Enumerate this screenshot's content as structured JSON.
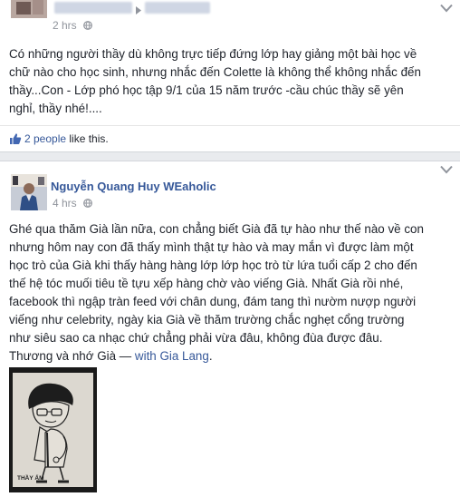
{
  "post1": {
    "author_name": "",
    "timestamp": "2 hrs",
    "body": "Có những người thầy dù không trực tiếp đứng lớp hay giảng một bài học về\nchữ nào cho học sinh, nhưng nhắc đến Colette là không thể không nhắc đến\nthầy...Con - Lớp phó học tập 9/1 của 15 năm trước -cầu chúc thầy sẽ yên\nnghỉ, thầy nhé!....",
    "likes": {
      "link_text": "2 people",
      "suffix": " like this."
    }
  },
  "post2": {
    "author_name": "Nguyễn Quang Huy WEaholic",
    "timestamp": "4 hrs",
    "body": "Ghé qua thăm Già lần nữa, con chẳng biết Già đã tự hào như thế nào về con\nnhưng hôm nay con đã thấy mình thật tự hào và may mắn vì được làm một\nhọc trò của Già khi thấy hàng hàng lớp lớp học trò từ lứa tuổi cấp 2 cho đến\nthế hệ tóc muối tiêu tề tựu xếp hàng chờ vào viếng Già. Nhất Già rồi nhé,\nfacebook thì ngập tràn feed với chân dung, đám tang thì nườm nượp người\nviếng như celebrity, ngày kia Già về thăm trường chắc nghẹt cổng trường\nnhư siêu sao ca nhạc chứ chẳng phải vừa đâu, không đùa được đâu.\nThương và nhớ Già — ",
    "tag_prefix": "with ",
    "tagged_person": "Gia Lang",
    "tag_suffix": ".",
    "photo_caption": "THẦY ẤM"
  },
  "icons": {
    "post_menu": "chevron-down-icon",
    "privacy": "globe-icon",
    "like": "thumbs-up-icon",
    "breadcrumb": "triangle-right-icon"
  },
  "colors": {
    "link": "#365899",
    "text": "#1d2129",
    "muted": "#90949c",
    "background": "#e9ebee"
  }
}
